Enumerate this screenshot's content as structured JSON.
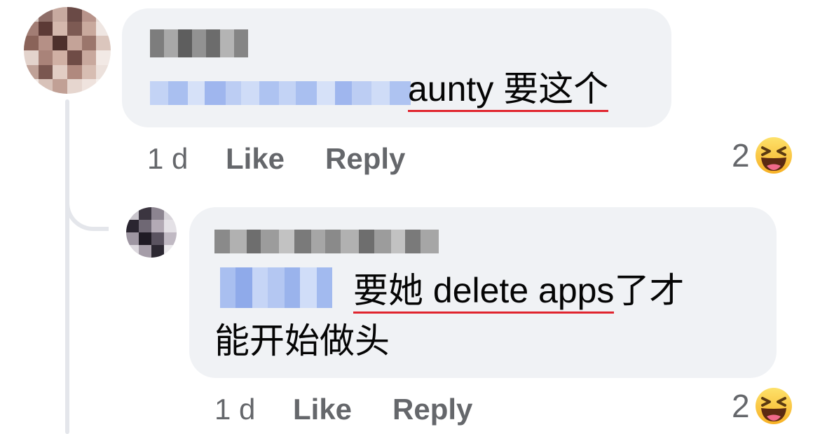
{
  "comments": [
    {
      "author": "",
      "mention": "",
      "text_underlined": "aunty 要这个",
      "text_rest": "",
      "timestamp": "1 d",
      "like_label": "Like",
      "reply_label": "Reply",
      "reaction_count": "2",
      "reaction_icon": "haha-emoji-icon"
    },
    {
      "author": "",
      "mention": "",
      "text_underlined": "要她 delete apps",
      "text_rest": "了才",
      "text_line2": "能开始做头",
      "timestamp": "1 d",
      "like_label": "Like",
      "reply_label": "Reply",
      "reaction_count": "2",
      "reaction_icon": "haha-emoji-icon"
    }
  ],
  "colors": {
    "bubble": "#f0f2f5",
    "text": "#050505",
    "meta": "#65676b",
    "spellcheck_underline": "#e0242e",
    "thread_line": "#e4e6eb",
    "mention_blur": "#a9bff0"
  }
}
